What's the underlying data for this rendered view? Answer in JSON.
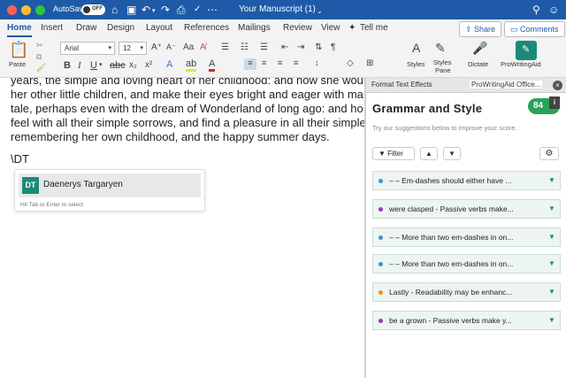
{
  "window": {
    "autosave_label": "AutoSave",
    "autosave_state": "OFF",
    "document_title": "Your Manuscript (1)"
  },
  "ribbon_tabs": [
    "Home",
    "Insert",
    "Draw",
    "Design",
    "Layout",
    "References",
    "Mailings",
    "Review",
    "View",
    "Tell me"
  ],
  "share_label": "Share",
  "comments_label": "Comments",
  "ribbon": {
    "paste_label": "Paste",
    "font_name": "Arial",
    "font_size": "12",
    "styles_label": "Styles",
    "styles_pane_label_1": "Styles",
    "styles_pane_label_2": "Pane",
    "dictate_label": "Dictate",
    "prowritingaid_label": "ProWritingAid"
  },
  "document": {
    "lines": [
      "years, the simple and loving heart of her childhood: and how she wou",
      "her other little children, and make their eyes bright and eager with ma",
      "tale, perhaps even with the dream of Wonderland of long ago: and ho",
      "feel with all their simple sorrows, and find a pleasure in all their simple",
      "remembering her own childhood, and the happy summer days."
    ],
    "typed_text": "\\DT",
    "autocomplete": {
      "initials": "DT",
      "name": "Daenerys Targaryen",
      "hint": "Hit Tab or Enter to select"
    }
  },
  "pane_tabs": {
    "tab1": "Format Text Effects",
    "tab2": "ProWritingAid Office...",
    "close": "×"
  },
  "pwa": {
    "title": "Grammar and Style",
    "score": "84",
    "subtitle": "Try our suggestions below to improve your score.",
    "filter_label": "Filter",
    "issues": [
      {
        "text": "– –  Em-dashes should either have ...",
        "dot_color": "#3d8fd6"
      },
      {
        "text": "were clasped  -  Passive verbs make...",
        "dot_color": "#8e3dbf"
      },
      {
        "text": "– –  More than two em-dashes in on...",
        "dot_color": "#3d8fd6"
      },
      {
        "text": "– –  More than two em-dashes in on...",
        "dot_color": "#3d8fd6"
      },
      {
        "text": "Lastly  -  Readability may be enhanc...",
        "dot_color": "#f08a24"
      },
      {
        "text": "be a grown  -  Passive verbs make y...",
        "dot_color": "#8e3dbf"
      }
    ]
  },
  "colors": {
    "title_bar": "#1f5aa8",
    "accent_teal": "#1b8a7a",
    "score_green": "#27a35a"
  }
}
